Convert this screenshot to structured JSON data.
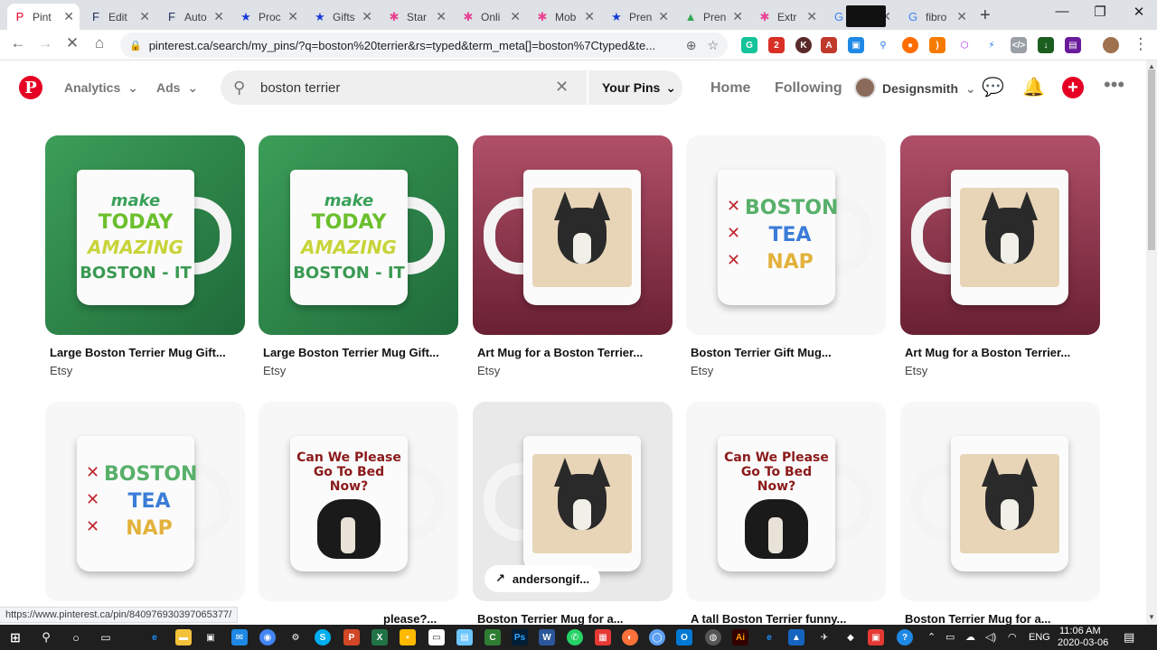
{
  "browser": {
    "tabs": [
      {
        "title": "Pint",
        "icon": "pinterest-icon",
        "color": "#e60023",
        "glyph": "P"
      },
      {
        "title": "Edit",
        "icon": "framer-icon",
        "color": "#1d2b5a",
        "glyph": "F"
      },
      {
        "title": "Auto",
        "icon": "framer-icon",
        "color": "#1d2b5a",
        "glyph": "F"
      },
      {
        "title": "Proc",
        "icon": "star-icon",
        "color": "#1a3dd6",
        "glyph": "★"
      },
      {
        "title": "Gifts",
        "icon": "star-icon",
        "color": "#1a3dd6",
        "glyph": "★"
      },
      {
        "title": "Star",
        "icon": "asterisk-icon",
        "color": "#e84393",
        "glyph": "✱"
      },
      {
        "title": "Onli",
        "icon": "asterisk-icon",
        "color": "#e84393",
        "glyph": "✱"
      },
      {
        "title": "Mob",
        "icon": "asterisk-icon",
        "color": "#e84393",
        "glyph": "✱"
      },
      {
        "title": "Pren",
        "icon": "star-icon",
        "color": "#1a3dd6",
        "glyph": "★"
      },
      {
        "title": "Pren",
        "icon": "drive-icon",
        "color": "#34a853",
        "glyph": "▲"
      },
      {
        "title": "Extr",
        "icon": "asterisk-icon",
        "color": "#e84393",
        "glyph": "✱"
      },
      {
        "title": "",
        "icon": "google-icon",
        "color": "#4285f4",
        "glyph": "G"
      },
      {
        "title": "fibro",
        "icon": "google-icon",
        "color": "#4285f4",
        "glyph": "G"
      }
    ],
    "url": "pinterest.ca/search/my_pins/?q=boston%20terrier&rs=typed&term_meta[]=boston%7Ctyped&te...",
    "status_url": "https://www.pinterest.ca/pin/840976930397065377/"
  },
  "header": {
    "analytics_label": "Analytics",
    "ads_label": "Ads",
    "search_value": "boston terrier",
    "scope_label": "Your Pins",
    "home_label": "Home",
    "following_label": "Following",
    "user_name": "Designsmith"
  },
  "pins": [
    {
      "title": "Large Boston Terrier Mug Gift...",
      "source": "Etsy",
      "style": "green-text"
    },
    {
      "title": "Large Boston Terrier Mug Gift...",
      "source": "Etsy",
      "style": "green-text"
    },
    {
      "title": "Art Mug for a Boston Terrier...",
      "source": "Etsy",
      "style": "maroon-art"
    },
    {
      "title": "Boston Terrier Gift Mug...",
      "source": "Etsy",
      "style": "white-tea"
    },
    {
      "title": "Art Mug for a Boston Terrier...",
      "source": "Etsy",
      "style": "maroon-art"
    },
    {
      "title": "",
      "source": "",
      "style": "white-tea"
    },
    {
      "title": "please?...",
      "source": "",
      "style": "white-bed"
    },
    {
      "title": "Boston Terrier Mug for a...",
      "source": "",
      "style": "grey-art",
      "chip": "andersongif..."
    },
    {
      "title": "A tall Boston Terrier funny...",
      "source": "",
      "style": "white-bed"
    },
    {
      "title": "Boston Terrier Mug for a...",
      "source": "",
      "style": "white-art"
    }
  ],
  "mug_text": {
    "make": "make",
    "today": "TODAY",
    "amazing": "AMAZING",
    "boston_it": "BOSTON - IT",
    "boston": "BOSTON",
    "tea": "TEA",
    "nap": "NAP",
    "bed": "Can We Please Go To Bed Now?"
  },
  "taskbar": {
    "time": "11:06 AM",
    "date": "2020-03-06",
    "lang": "ENG"
  }
}
